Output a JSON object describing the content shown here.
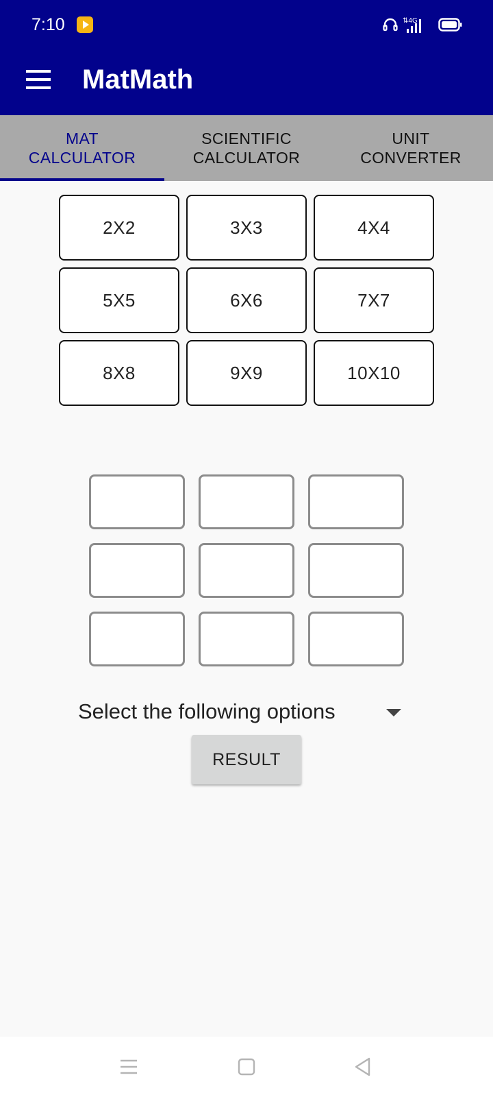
{
  "status_bar": {
    "time": "7:10",
    "icons": [
      "media-play-icon",
      "headset-icon",
      "signal-4g-icon",
      "battery-icon"
    ]
  },
  "app_bar": {
    "title": "MatMath",
    "menu_icon": "hamburger-menu-icon",
    "background": "#02028c"
  },
  "tabs": [
    {
      "label_line1": "MAT",
      "label_line2": "CALCULATOR",
      "active": true
    },
    {
      "label_line1": "SCIENTIFIC",
      "label_line2": "CALCULATOR",
      "active": false
    },
    {
      "label_line1": "UNIT",
      "label_line2": "CONVERTER",
      "active": false
    }
  ],
  "matrix_sizes": [
    "2X2",
    "3X3",
    "4X4",
    "5X5",
    "6X6",
    "7X7",
    "8X8",
    "9X9",
    "10X10"
  ],
  "matrix": {
    "rows": 3,
    "cols": 3,
    "values": [
      "",
      "",
      "",
      "",
      "",
      "",
      "",
      "",
      ""
    ]
  },
  "options": {
    "selected": "Select the following options"
  },
  "result_button": {
    "label": "RESULT"
  },
  "nav_bar": {
    "icons": [
      "recent-apps-icon",
      "home-icon",
      "back-icon"
    ]
  },
  "colors": {
    "primary": "#02028c",
    "tab_bar": "#a9a9a9",
    "tab_active_text": "#05058c"
  }
}
